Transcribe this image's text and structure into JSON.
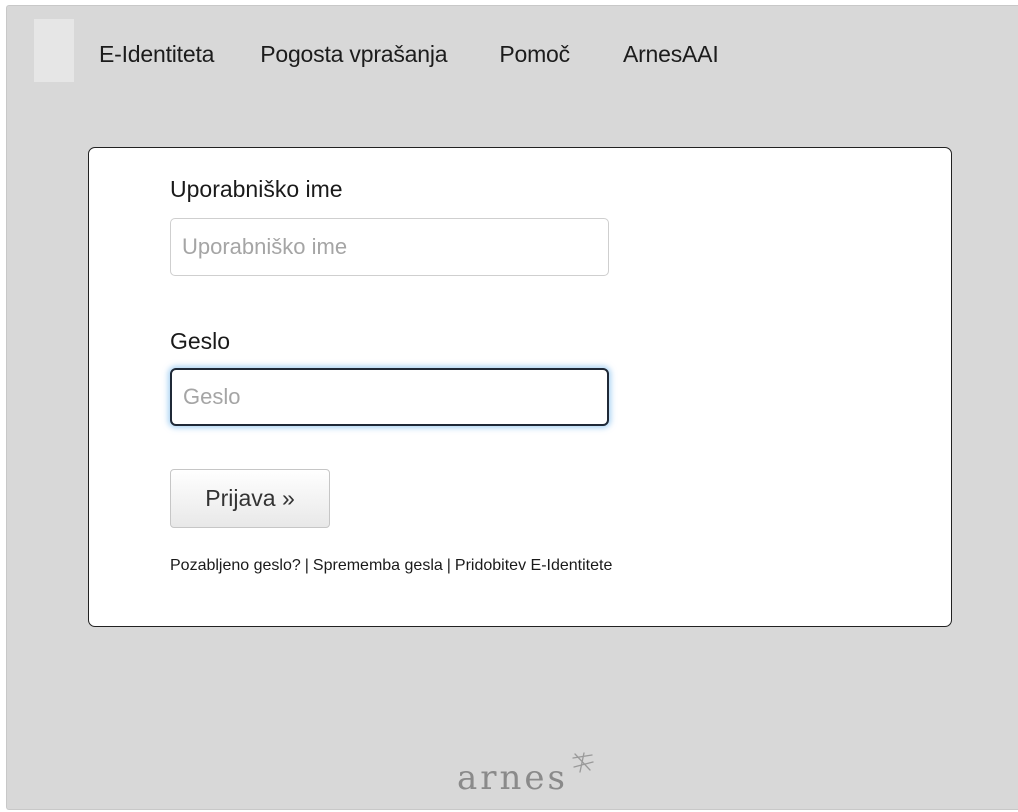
{
  "nav": {
    "items": [
      {
        "label": "E-Identiteta"
      },
      {
        "label": "Pogosta vprašanja"
      },
      {
        "label": "Pomoč"
      },
      {
        "label": "ArnesAAI"
      }
    ]
  },
  "login": {
    "username_label": "Uporabniško ime",
    "username_placeholder": "Uporabniško ime",
    "username_value": "",
    "password_label": "Geslo",
    "password_placeholder": "Geslo",
    "password_value": "",
    "submit_label": "Prijava »",
    "links": {
      "forgot_password": "Pozabljeno geslo?",
      "separator": "|",
      "change_password": "Sprememba gesla",
      "obtain_identity": "Pridobitev E-Identitete"
    }
  },
  "footer": {
    "logo_text": "arnes",
    "logo_icon": "arnes-star-icon"
  },
  "colors": {
    "panel_background": "#d8d8d8",
    "card_border": "#222222",
    "focus_glow": "#66afe9"
  }
}
